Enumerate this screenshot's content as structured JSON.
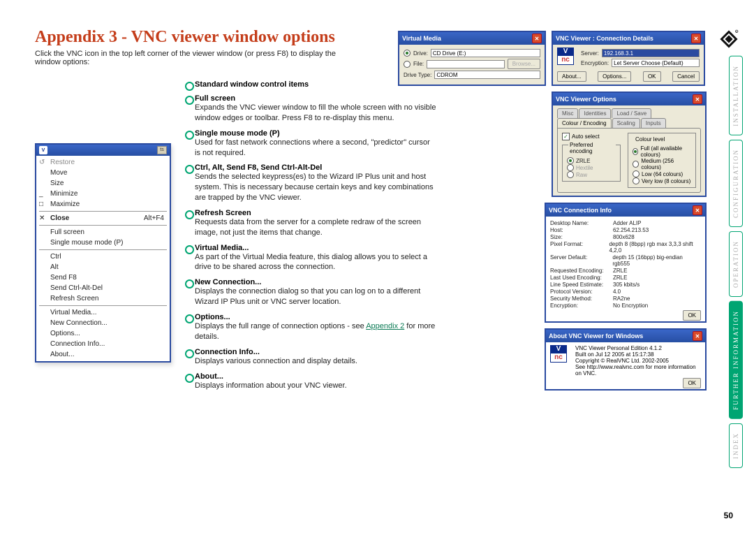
{
  "page": {
    "title": "Appendix 3 - VNC viewer window options",
    "intro": "Click the VNC icon in the top left corner of the viewer window (or press F8) to display the window options:",
    "number": "50"
  },
  "context_menu": {
    "items": [
      {
        "label": "Restore",
        "disabled": true,
        "glyph": "↺"
      },
      {
        "label": "Move"
      },
      {
        "label": "Size"
      },
      {
        "label": "Minimize",
        "glyph": "_"
      },
      {
        "label": "Maximize",
        "glyph": "□"
      },
      {
        "sep": true
      },
      {
        "label": "Close",
        "shortcut": "Alt+F4",
        "glyph": "✕",
        "bold": true
      },
      {
        "sep": true
      },
      {
        "label": "Full screen"
      },
      {
        "label": "Single mouse mode (P)"
      },
      {
        "sep": true
      },
      {
        "label": "Ctrl"
      },
      {
        "label": "Alt"
      },
      {
        "label": "Send F8"
      },
      {
        "label": "Send Ctrl-Alt-Del"
      },
      {
        "label": "Refresh Screen"
      },
      {
        "sep": true
      },
      {
        "label": "Virtual Media..."
      },
      {
        "label": "New Connection..."
      },
      {
        "label": "Options..."
      },
      {
        "label": "Connection Info..."
      },
      {
        "label": "About..."
      }
    ]
  },
  "descriptions": [
    {
      "title": "Standard window control items",
      "body": ""
    },
    {
      "title": "Full screen",
      "body": "Expands the VNC viewer window to fill the whole screen with no visible window edges or toolbar. Press F8 to re-display this menu."
    },
    {
      "title": "Single mouse mode (P)",
      "body": "Used for fast network connections where a second, \"predictor\" cursor is not required."
    },
    {
      "title": "Ctrl, Alt, Send F8, Send Ctrl-Alt-Del",
      "body": "Sends the selected keypress(es) to the Wizard IP Plus unit and host system. This is necessary because certain keys and key combinations are trapped by the VNC viewer."
    },
    {
      "title": "Refresh Screen",
      "body": "Requests data from the server for a complete redraw of the screen image, not just the items that change."
    },
    {
      "title": "Virtual Media...",
      "body": "As part of the Virtual Media feature, this dialog allows you to select a drive to be shared across the connection."
    },
    {
      "title": "New Connection...",
      "body": "Displays the connection dialog so that you can log on to a different Wizard IP Plus unit or VNC server location."
    },
    {
      "title": "Options...",
      "body_pre": "Displays the full range of connection options - see ",
      "link": "Appendix 2",
      "body_post": " for more details."
    },
    {
      "title": "Connection Info...",
      "body": "Displays various connection and display details."
    },
    {
      "title": "About...",
      "body": "Displays information about your VNC viewer."
    }
  ],
  "virtual_media": {
    "title": "Virtual Media",
    "drive_label": "Drive:",
    "drive_value": "CD Drive (E:)",
    "file_label": "File:",
    "drive_type_label": "Drive Type:",
    "drive_type_value": "CDROM",
    "browse": "Browse..."
  },
  "conn_details": {
    "title": "VNC Viewer : Connection Details",
    "server_label": "Server:",
    "server_value": "192.168.3.1",
    "enc_label": "Encryption:",
    "enc_value": "Let Server Choose (Default)",
    "about": "About...",
    "options": "Options...",
    "ok": "OK",
    "cancel": "Cancel"
  },
  "options": {
    "title": "VNC Viewer Options",
    "tabs": [
      "Misc",
      "Identities",
      "Load / Save",
      "Colour / Encoding",
      "Scaling",
      "Inputs"
    ],
    "auto": "Auto select",
    "pref": "Preferred encoding",
    "encodings": [
      "ZRLE",
      "Hextile",
      "Raw"
    ],
    "colour_title": "Colour level",
    "colours": [
      "Full (all available colours)",
      "Medium (256 colours)",
      "Low (64 colours)",
      "Very low (8 colours)"
    ]
  },
  "conn_info": {
    "title": "VNC Connection Info",
    "rows": [
      [
        "Desktop Name:",
        "Adder ALIP"
      ],
      [
        "Host:",
        "62.254.213.53"
      ],
      [
        "Size:",
        "800x628"
      ],
      [
        "Pixel Format:",
        "depth 8 (8bpp) rgb max 3,3,3 shift 4,2,0"
      ],
      [
        "Server Default:",
        "depth 15 (16bpp) big-endian rgb555"
      ],
      [
        "Requested Encoding:",
        "ZRLE"
      ],
      [
        "Last Used Encoding:",
        "ZRLE"
      ],
      [
        "Line Speed Estimate:",
        "305 kbits/s"
      ],
      [
        "Protocol Version:",
        "4.0"
      ],
      [
        "Security Method:",
        "RA2ne"
      ],
      [
        "Encryption:",
        "No Encryption"
      ]
    ],
    "ok": "OK"
  },
  "about": {
    "title": "About VNC Viewer for Windows",
    "lines": [
      "VNC Viewer Personal Edition       4.1.2",
      "Built on Jul 12 2005 at 15:17:38",
      "Copyright © RealVNC Ltd. 2002-2005",
      "See http://www.realvnc.com for more information on VNC."
    ],
    "ok": "OK"
  },
  "sidenav": [
    {
      "label": "INSTALLATION"
    },
    {
      "label": "CONFIGURATION"
    },
    {
      "label": "OPERATION"
    },
    {
      "label": "FURTHER INFORMATION",
      "active": true
    },
    {
      "label": "INDEX"
    }
  ]
}
